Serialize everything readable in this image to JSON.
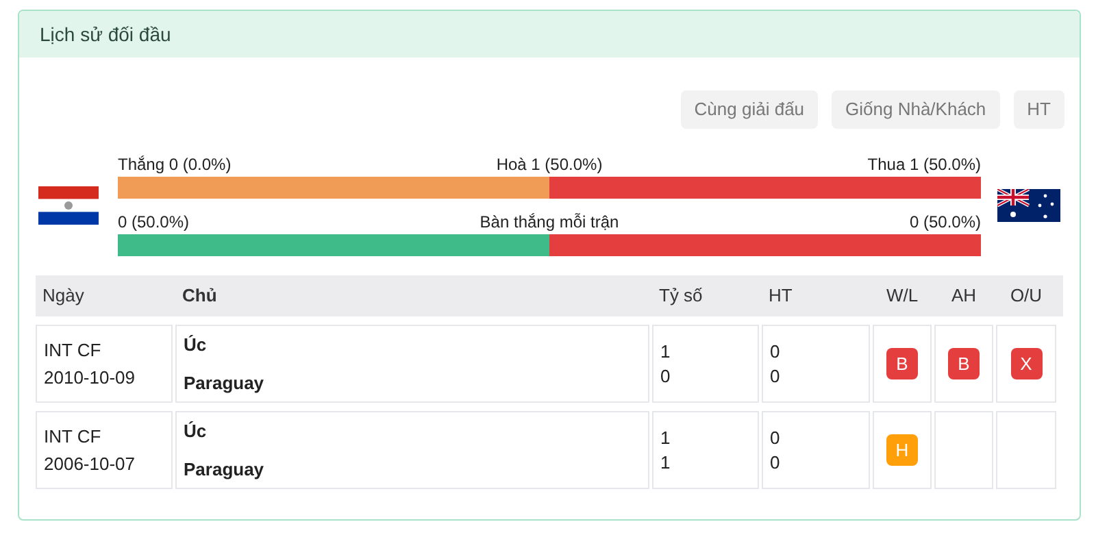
{
  "panel": {
    "title": "Lịch sử đối đầu"
  },
  "filters": [
    {
      "label": "Cùng giải đấu",
      "selected": false
    },
    {
      "label": "Giống Nhà/Khách",
      "selected": false
    },
    {
      "label": "HT",
      "selected": false
    }
  ],
  "bars": [
    {
      "left": "Thắng 0 (0.0%)",
      "center": "Hoà 1 (50.0%)",
      "right": "Thua 1 (50.0%)",
      "kind": "result",
      "level": 0.5
    },
    {
      "left": "0 (50.0%)",
      "center": "Bàn thắng mỗi trận",
      "right": "0 (50.0%)",
      "kind": "goals",
      "level": 0.5
    }
  ],
  "table": {
    "columns": [
      "Ngày",
      "Chủ",
      "Tỷ số",
      "HT",
      "W/L",
      "AH",
      "O/U"
    ],
    "rows": [
      {
        "competition": "INT CF",
        "date": "2010-10-09",
        "home": "Úc",
        "away": "Paraguay",
        "score": [
          "1",
          "0"
        ],
        "ht": [
          "0",
          "0"
        ],
        "wl": {
          "text": "B",
          "color": "#e53e3e"
        },
        "ah": {
          "text": "B",
          "color": "#e53e3e"
        },
        "ou": {
          "text": "X",
          "color": "#e53e3e"
        }
      },
      {
        "competition": "INT CF",
        "date": "2006-10-07",
        "home": "Úc",
        "away": "Paraguay",
        "score": [
          "1",
          "1"
        ],
        "ht": [
          "0",
          "0"
        ],
        "wl": {
          "text": "H",
          "color": "#ff9f0a"
        }
      }
    ]
  }
}
